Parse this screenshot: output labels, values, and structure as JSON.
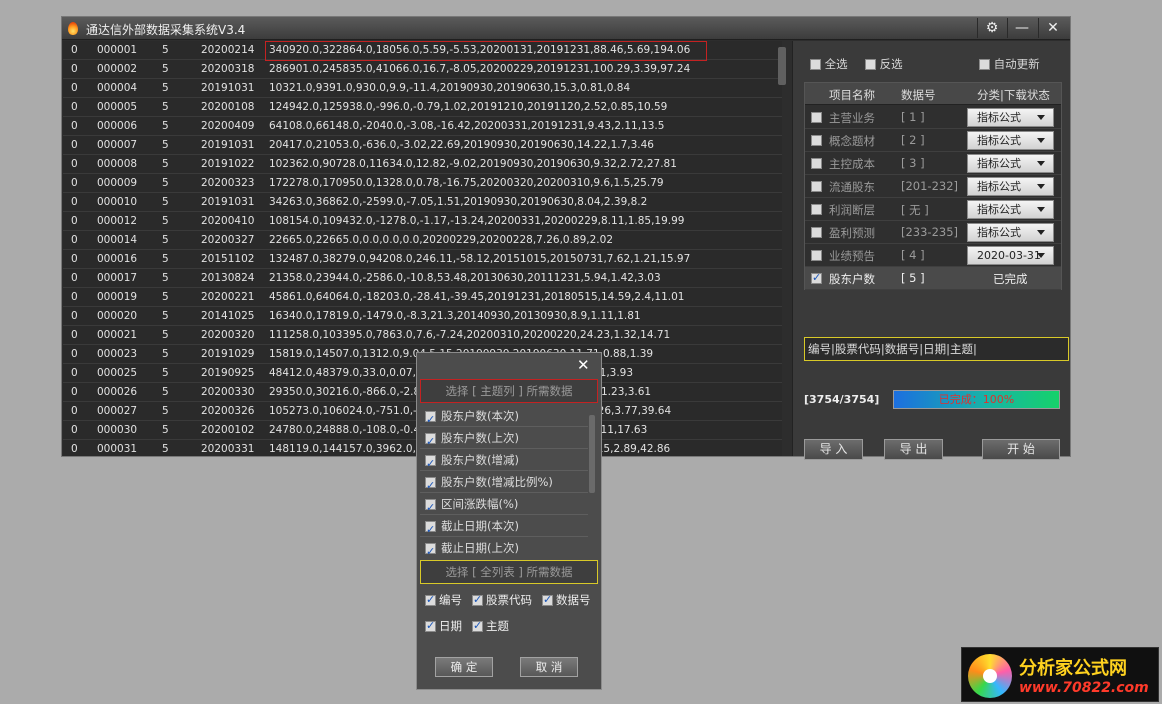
{
  "window": {
    "title": "通达信外部数据采集系统V3.4",
    "controls": {
      "settings_icon": "⚙",
      "minimize": "—",
      "close": "✕"
    }
  },
  "grid": {
    "rows": [
      [
        "0",
        "000001",
        "5",
        "20200214",
        "340920.0,322864.0,18056.0,5.59,-5.53,20200131,20191231,88.46,5.69,194.06"
      ],
      [
        "0",
        "000002",
        "5",
        "20200318",
        "286901.0,245835.0,41066.0,16.7,-8.05,20200229,20191231,100.29,3.39,97.24"
      ],
      [
        "0",
        "000004",
        "5",
        "20191031",
        "10321.0,9391.0,930.0,9.9,-11.4,20190930,20190630,15.3,0.81,0.84"
      ],
      [
        "0",
        "000005",
        "5",
        "20200108",
        "124942.0,125938.0,-996.0,-0.79,1.02,20191210,20191120,2.52,0.85,10.59"
      ],
      [
        "0",
        "000006",
        "5",
        "20200409",
        "64108.0,66148.0,-2040.0,-3.08,-16.42,20200331,20191231,9.43,2.11,13.5"
      ],
      [
        "0",
        "000007",
        "5",
        "20191031",
        "20417.0,21053.0,-636.0,-3.02,22.69,20190930,20190630,14.22,1.7,3.46"
      ],
      [
        "0",
        "000008",
        "5",
        "20191022",
        "102362.0,90728.0,11634.0,12.82,-9.02,20190930,20190630,9.32,2.72,27.81"
      ],
      [
        "0",
        "000009",
        "5",
        "20200323",
        "172278.0,170950.0,1328.0,0.78,-16.75,20200320,20200310,9.6,1.5,25.79"
      ],
      [
        "0",
        "000010",
        "5",
        "20191031",
        "34263.0,36862.0,-2599.0,-7.05,1.51,20190930,20190630,8.04,2.39,8.2"
      ],
      [
        "0",
        "000012",
        "5",
        "20200410",
        "108154.0,109432.0,-1278.0,-1.17,-13.24,20200331,20200229,8.11,1.85,19.99"
      ],
      [
        "0",
        "000014",
        "5",
        "20200327",
        "22665.0,22665.0,0.0,0.0,0.0,20200229,20200228,7.26,0.89,2.02"
      ],
      [
        "0",
        "000016",
        "5",
        "20151102",
        "132487.0,38279.0,94208.0,246.11,-58.12,20151015,20150731,7.62,1.21,15.97"
      ],
      [
        "0",
        "000017",
        "5",
        "20130824",
        "21358.0,23944.0,-2586.0,-10.8,53.48,20130630,20111231,5.94,1.42,3.03"
      ],
      [
        "0",
        "000019",
        "5",
        "20200221",
        "45861.0,64064.0,-18203.0,-28.41,-39.45,20191231,20180515,14.59,2.4,11.01"
      ],
      [
        "0",
        "000020",
        "5",
        "20141025",
        "16340.0,17819.0,-1479.0,-8.3,21.3,20140930,20130930,8.9,1.11,1.81"
      ],
      [
        "0",
        "000021",
        "5",
        "20200320",
        "111258.0,103395.0,7863.0,7.6,-7.24,20200310,20200220,24.23,1.32,14.71"
      ],
      [
        "0",
        "000023",
        "5",
        "20191029",
        "15819.0,14507.0,1312.0,9.04,5.15,20190930,20190630,11.71,0.88,1.39"
      ],
      [
        "0",
        "000025",
        "5",
        "20190925",
        "48412.0,48379.0,33.0,0.07,18.0,20190910,20190830,10.0,0.81,3.93"
      ],
      [
        "0",
        "000026",
        "5",
        "20200330",
        "29350.0,30216.0,-866.0,-2.87,-7.6,20200320,20191231,16.08,1.23,3.61"
      ],
      [
        "0",
        "000027",
        "5",
        "20200326",
        "105273.0,106024.0,-751.0,-0.71,-9.2,20200320,20200310,30.26,3.77,39.64"
      ],
      [
        "0",
        "000030",
        "5",
        "20200102",
        "24780.0,24888.0,-108.0,-0.43,5.1,20191231,20191210,16.5,7.11,17.63"
      ],
      [
        "0",
        "000031",
        "5",
        "20200331",
        "148119.0,144157.0,3962.0,2.75,-8.8,20200320,20200310,16.15,2.89,42.86"
      ]
    ]
  },
  "right": {
    "select_all": "全选",
    "invert": "反选",
    "auto_update": "自动更新",
    "headers": {
      "name": "项目名称",
      "num": "数据号",
      "status": "分类|下载状态"
    },
    "items": [
      {
        "name": "主营业务",
        "num": "[ 1 ]",
        "status": "指标公式",
        "checked": false
      },
      {
        "name": "概念题材",
        "num": "[ 2 ]",
        "status": "指标公式",
        "checked": false
      },
      {
        "name": "主控成本",
        "num": "[ 3 ]",
        "status": "指标公式",
        "checked": false
      },
      {
        "name": "流通股东",
        "num": "[201-232]",
        "status": "指标公式",
        "checked": false
      },
      {
        "name": "利润断层",
        "num": "[ 无 ]",
        "status": "指标公式",
        "checked": false
      },
      {
        "name": "盈利预测",
        "num": "[233-235]",
        "status": "指标公式",
        "checked": false
      },
      {
        "name": "业绩预告",
        "num": "[ 4 ]",
        "status": "2020-03-31",
        "checked": false
      },
      {
        "name": "股东户数",
        "num": "[ 5 ]",
        "status": "已完成",
        "checked": true
      }
    ],
    "fields": "编号|股票代码|数据号|日期|主题|",
    "count": "[3754/3754]",
    "progress_text": "已完成：100%",
    "progress": 1.0,
    "btn_import": "导 入",
    "btn_export": "导 出",
    "btn_start": "开 始"
  },
  "dialog": {
    "close": "✕",
    "head1": "选择 [ 主题列 ] 所需数据",
    "items": [
      {
        "label": "股东户数(本次)",
        "checked": true
      },
      {
        "label": "股东户数(上次)",
        "checked": true
      },
      {
        "label": "股东户数(增减)",
        "checked": true
      },
      {
        "label": "股东户数(增减比例%)",
        "checked": true
      },
      {
        "label": "区间涨跌幅(%)",
        "checked": true
      },
      {
        "label": "截止日期(本次)",
        "checked": true
      },
      {
        "label": "截止日期(上次)",
        "checked": true
      }
    ],
    "head2": "选择 [ 全列表 ] 所需数据",
    "cols": [
      "编号",
      "股票代码",
      "数据号",
      "日期",
      "主题"
    ],
    "ok": "确 定",
    "cancel": "取 消"
  },
  "watermark": {
    "line1": "分析家公式网",
    "line2": "www.70822.com"
  }
}
